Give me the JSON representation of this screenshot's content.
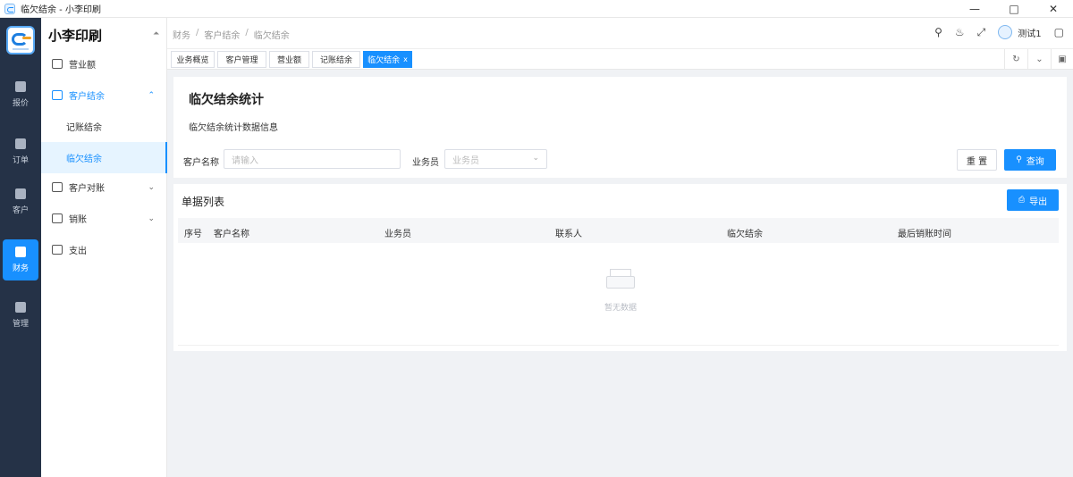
{
  "window": {
    "title": "临欠结余 - 小李印刷",
    "controls": [
      "minimize-icon",
      "maximize-icon",
      "close-icon"
    ]
  },
  "rail": {
    "items": [
      {
        "label": "报价",
        "icon": "calendar-icon"
      },
      {
        "label": "订单",
        "icon": "clipboard-icon"
      },
      {
        "label": "客户",
        "icon": "user-icon"
      },
      {
        "label": "财务",
        "icon": "wallet-icon",
        "active": true
      },
      {
        "label": "管理",
        "icon": "gear-icon"
      }
    ]
  },
  "menu": {
    "brand": "小李印刷",
    "items": [
      {
        "label": "营业额"
      },
      {
        "label": "客户结余",
        "open": true
      },
      {
        "label": "客户对账"
      },
      {
        "label": "销账"
      },
      {
        "label": "支出"
      }
    ],
    "sub_items": [
      {
        "label": "记账结余"
      },
      {
        "label": "临欠结余",
        "active": true
      }
    ]
  },
  "header": {
    "breadcrumb": [
      "财务",
      "客户结余",
      "临欠结余"
    ],
    "user": "测试1"
  },
  "tabs": [
    {
      "label": "业务概览"
    },
    {
      "label": "客户管理"
    },
    {
      "label": "营业额"
    },
    {
      "label": "记账结余"
    },
    {
      "label": "临欠结余",
      "active": true,
      "close": "x"
    }
  ],
  "query": {
    "title": "临欠结余统计",
    "description": "临欠结余统计数据信息",
    "customer_label": "客户名称",
    "customer_placeholder": "请输入",
    "salesman_label": "业务员",
    "salesman_placeholder": "业务员",
    "reset_label": "重 置",
    "search_label": "查询"
  },
  "table": {
    "title": "单据列表",
    "export_label": "导出",
    "columns": [
      "序号",
      "客户名称",
      "业务员",
      "联系人",
      "临欠结余",
      "最后销账时间"
    ],
    "rows": [],
    "empty_text": "暂无数据"
  },
  "colors": {
    "accent": "#1890ff",
    "rail_bg": "#253247",
    "page_bg": "#f0f2f5"
  }
}
